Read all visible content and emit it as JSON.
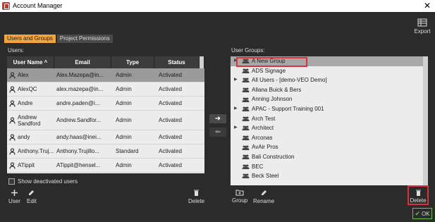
{
  "window": {
    "title": "Account Manager",
    "close_glyph": "✕"
  },
  "toolbar": {
    "export_label": "Export"
  },
  "tabs": [
    {
      "label": "Users and Groups",
      "active": true
    },
    {
      "label": "Project Permissions",
      "active": false
    }
  ],
  "users": {
    "section_label": "Users:",
    "columns": {
      "name": "User Name ^",
      "email": "Email",
      "type": "Type",
      "status": "Status"
    },
    "rows": [
      {
        "name": "Alex",
        "email": "Alex.Mazepa@in...",
        "type": "Admin",
        "status": "Activated"
      },
      {
        "name": "AlexQC",
        "email": "alex.mazepa@in...",
        "type": "Admin",
        "status": "Activated"
      },
      {
        "name": "Andre",
        "email": "andre.paden@i...",
        "type": "Admin",
        "status": "Activated"
      },
      {
        "name": "Andrew Sandford",
        "email": "Andrew.Sandfor...",
        "type": "Admin",
        "status": "Activated"
      },
      {
        "name": "andy",
        "email": "andy.haas@inei...",
        "type": "Admin",
        "status": "Activated"
      },
      {
        "name": "Anthony.Truj...",
        "email": "Anthony.Trujillo...",
        "type": "Standard",
        "status": "Activated"
      },
      {
        "name": "ATippit",
        "email": "ATippit@hensel...",
        "type": "Admin",
        "status": "Activated"
      }
    ],
    "show_deactivated_label": "Show deactivated users",
    "buttons": {
      "user": "User",
      "edit": "Edit",
      "delete": "Delete"
    }
  },
  "move": {
    "right_glyph": "➜",
    "left_glyph": "⬅"
  },
  "groups": {
    "section_label": "User Groups:",
    "rows": [
      {
        "name": "A New Group",
        "expandable": true,
        "selected": true
      },
      {
        "name": "ADS Signage",
        "expandable": false
      },
      {
        "name": "All Users - [demo-VEO Demo]",
        "expandable": true
      },
      {
        "name": "Allana Buick & Bers",
        "expandable": false
      },
      {
        "name": "Anning Johnson",
        "expandable": false
      },
      {
        "name": "APAC - Support Training 001",
        "expandable": true
      },
      {
        "name": "Arch Test",
        "expandable": false
      },
      {
        "name": "Architect",
        "expandable": true
      },
      {
        "name": "Arconas",
        "expandable": false
      },
      {
        "name": "AvAir Pros",
        "expandable": false
      },
      {
        "name": "Bali Construction",
        "expandable": false
      },
      {
        "name": "BEC",
        "expandable": false
      },
      {
        "name": "Beck Steel",
        "expandable": false
      }
    ],
    "buttons": {
      "group": "Group",
      "rename": "Rename",
      "delete": "Delete"
    }
  },
  "footer": {
    "ok_label": "OK"
  },
  "colors": {
    "tab_active": "#f2a53c",
    "highlight": "#d9323a",
    "ok_accent": "#6bbf4e"
  }
}
